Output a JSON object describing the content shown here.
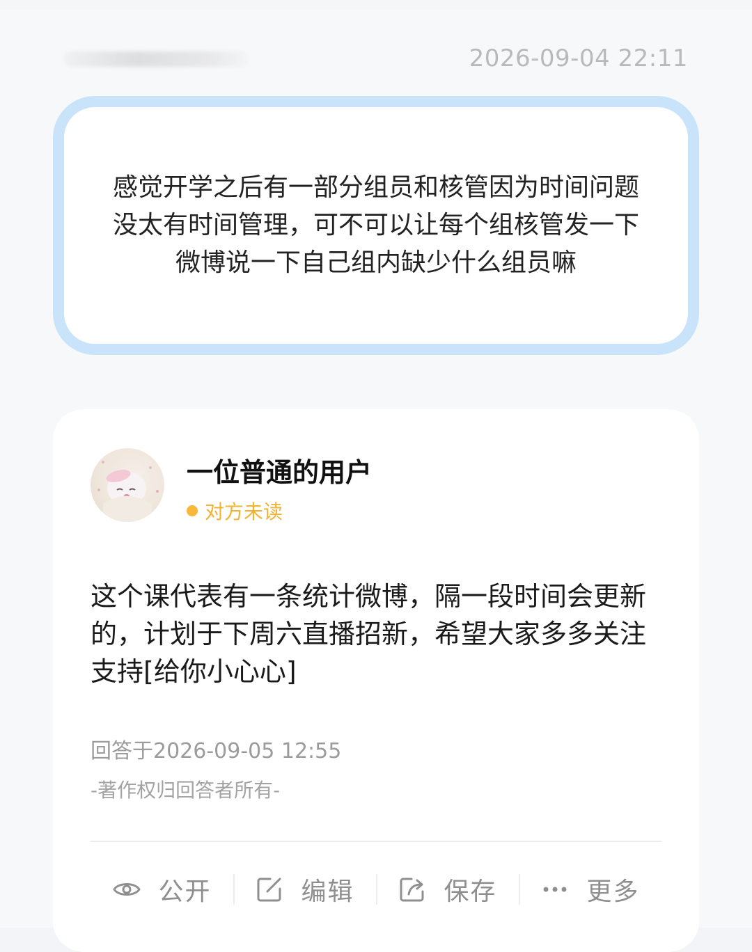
{
  "question": {
    "time": "2026-09-04 22:11",
    "text": "感觉开学之后有一部分组员和核管因为时间问题没太有时间管理，可不可以让每个组核管发一下微博说一下自己组内缺少什么组员嘛"
  },
  "answer": {
    "username": "一位普通的用户",
    "read_status": "对方未读",
    "text": " 这个课代表有一条统计微博，隔一段时间会更新的，计划于下周六直播招新，希望大家多多关注支持[给你小心心]",
    "answered_at": "回答于2026-09-05 12:55",
    "copyright": "-著作权归回答者所有-"
  },
  "actions": [
    {
      "label": "公开",
      "icon": "eye-icon"
    },
    {
      "label": "编辑",
      "icon": "edit-icon"
    },
    {
      "label": "保存",
      "icon": "share-icon"
    },
    {
      "label": "更多",
      "icon": "more-icon"
    }
  ],
  "colors": {
    "question_border": "#c9e3fb",
    "status_dot": "#f8b93a",
    "status_text": "#f2b233"
  }
}
